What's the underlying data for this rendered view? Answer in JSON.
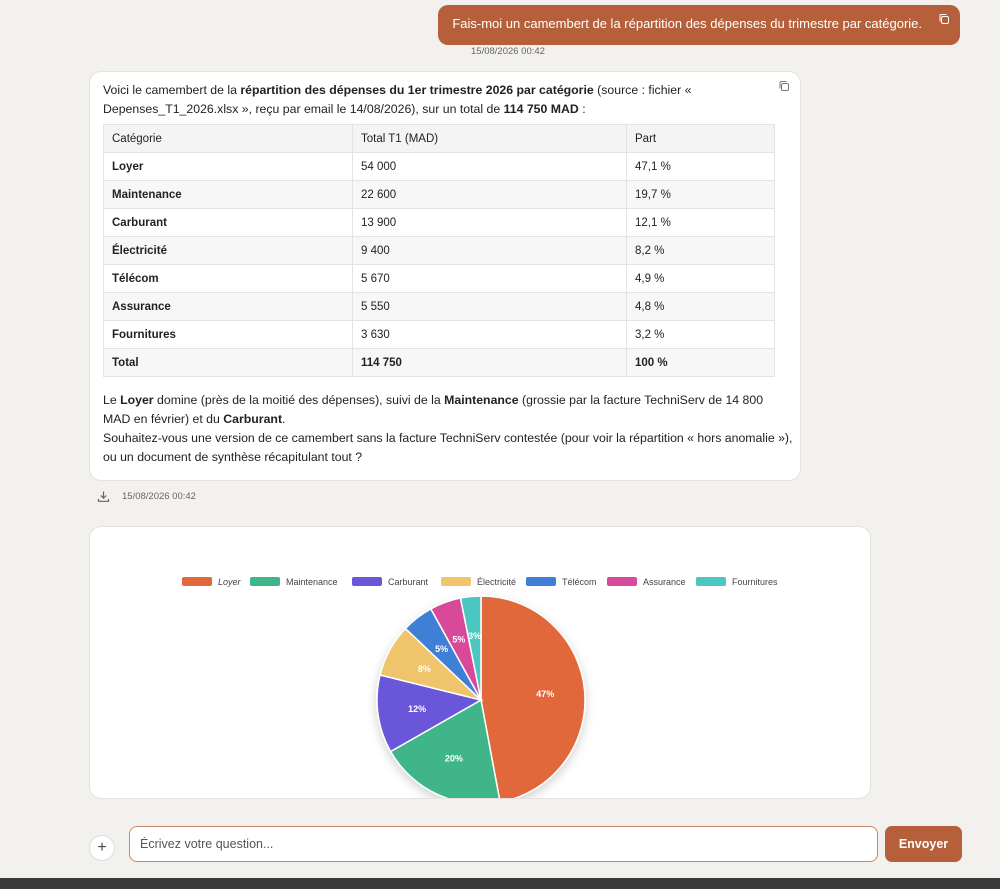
{
  "user_message": {
    "text": "Fais-moi un camembert de la répartition des dépenses du trimestre par catégorie.",
    "timestamp": "15/08/2026 00:42"
  },
  "assistant": {
    "intro_1": "Voici le camembert de la ",
    "intro_bold_1": "répartition des dépenses du 1er trimestre 2026 par catégorie",
    "intro_2": " (source : fichier « Depenses_T1_2026.xlsx », reçu par email le 14/08/2026), sur un total de ",
    "intro_bold_2": "114 750 MAD",
    "intro_3": " :",
    "table": {
      "headers": [
        "Catégorie",
        "Total T1 (MAD)",
        "Part"
      ],
      "rows": [
        [
          "Loyer",
          "54 000",
          "47,1 %"
        ],
        [
          "Maintenance",
          "22 600",
          "19,7 %"
        ],
        [
          "Carburant",
          "13 900",
          "12,1 %"
        ],
        [
          "Électricité",
          "9 400",
          "8,2 %"
        ],
        [
          "Télécom",
          "5 670",
          "4,9 %"
        ],
        [
          "Assurance",
          "5 550",
          "4,8 %"
        ],
        [
          "Fournitures",
          "3 630",
          "3,2 %"
        ]
      ],
      "total": [
        "Total",
        "114 750",
        "100 %"
      ]
    },
    "after_1": "Le ",
    "after_b1": "Loyer",
    "after_2": " domine (près de la moitié des dépenses), suivi de la ",
    "after_b2": "Maintenance",
    "after_3": " (grossie par la facture TechniServ de 14 800 MAD en février) et du ",
    "after_b3": "Carburant",
    "after_4": ".",
    "question": "Souhaitez-vous une version de ce camembert sans la facture TechniServ contestée (pour voir la répartition « hors anomalie »), ou un document de synthèse récapitulant tout ?",
    "timestamp": "15/08/2026 00:42"
  },
  "chart_data": {
    "type": "pie",
    "categories": [
      "Loyer",
      "Maintenance",
      "Carburant",
      "Électricité",
      "Télécom",
      "Assurance",
      "Fournitures"
    ],
    "values": [
      54000,
      22600,
      13900,
      9400,
      5670,
      5550,
      3630
    ],
    "data_labels": [
      "47%",
      "20%",
      "12%",
      "8%",
      "5%",
      "5%",
      "3%"
    ],
    "colors": [
      "#e0683a",
      "#3fb58a",
      "#6a56d9",
      "#f0c46a",
      "#3f7fd6",
      "#d84a9a",
      "#4cc6c0"
    ],
    "legend_position": "top"
  },
  "composer": {
    "placeholder": "Écrivez votre question...",
    "send_label": "Envoyer",
    "plus_label": "+"
  },
  "colors": {
    "accent": "#b5603a"
  }
}
